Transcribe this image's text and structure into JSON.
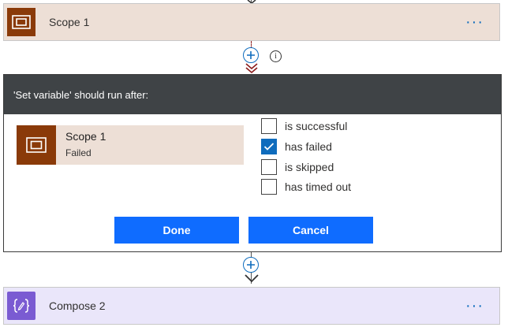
{
  "scope_card": {
    "title": "Scope 1",
    "more": "···"
  },
  "dialog": {
    "header": "'Set variable' should run after:",
    "scope_ref": {
      "title": "Scope 1",
      "status": "Failed"
    },
    "options": [
      {
        "label": "is successful",
        "checked": false
      },
      {
        "label": "has failed",
        "checked": true
      },
      {
        "label": "is skipped",
        "checked": false
      },
      {
        "label": "has timed out",
        "checked": false
      }
    ],
    "done_label": "Done",
    "cancel_label": "Cancel"
  },
  "compose_card": {
    "title": "Compose 2",
    "more": "···"
  },
  "colors": {
    "scope_brand": "#8a3a09",
    "scope_bg": "#eddfd6",
    "compose_brand": "#7a5bd2",
    "compose_bg": "#eae6fa",
    "primary_button": "#0f6cff",
    "dialog_header": "#3f4346",
    "run_after_arrow": "#8b1a1a"
  },
  "icons": {
    "scope": "scope-icon",
    "compose": "compose-icon",
    "plus": "plus-icon",
    "info": "info-icon",
    "check": "checkmark-icon"
  }
}
